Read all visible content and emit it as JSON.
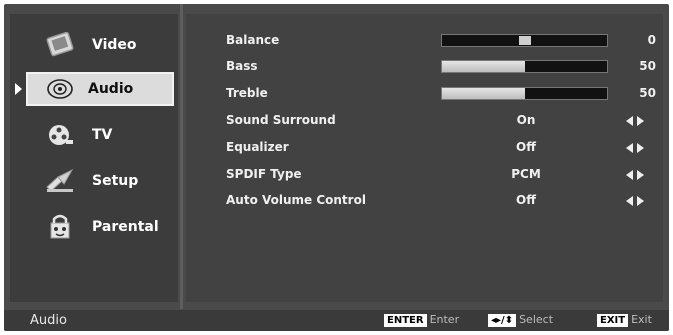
{
  "sidebar": {
    "items": [
      {
        "label": "Video",
        "icon": "video-icon"
      },
      {
        "label": "Audio",
        "icon": "audio-icon",
        "selected": true
      },
      {
        "label": "TV",
        "icon": "tv-reel-icon"
      },
      {
        "label": "Setup",
        "icon": "setup-icon"
      },
      {
        "label": "Parental",
        "icon": "parental-icon"
      }
    ]
  },
  "settings": {
    "balance": {
      "label": "Balance",
      "value": "0",
      "level": 0.5
    },
    "bass": {
      "label": "Bass",
      "value": "50",
      "level": 0.5
    },
    "treble": {
      "label": "Treble",
      "value": "50",
      "level": 0.5
    },
    "sound_surround": {
      "label": "Sound Surround",
      "value": "On"
    },
    "equalizer": {
      "label": "Equalizer",
      "value": "Off"
    },
    "spdif_type": {
      "label": "SPDIF Type",
      "value": "PCM"
    },
    "auto_volume": {
      "label": "Auto Volume Control",
      "value": "Off"
    }
  },
  "footer": {
    "title": "Audio",
    "enter_key": "ENTER",
    "enter_label": "Enter",
    "select_key": "◂▸/⬍",
    "select_label": "Select",
    "exit_key": "EXIT",
    "exit_label": "Exit"
  },
  "colors": {
    "background": "#4a4a4a",
    "selected_item": "#dcdcdc",
    "text": "#f0f0f0"
  }
}
